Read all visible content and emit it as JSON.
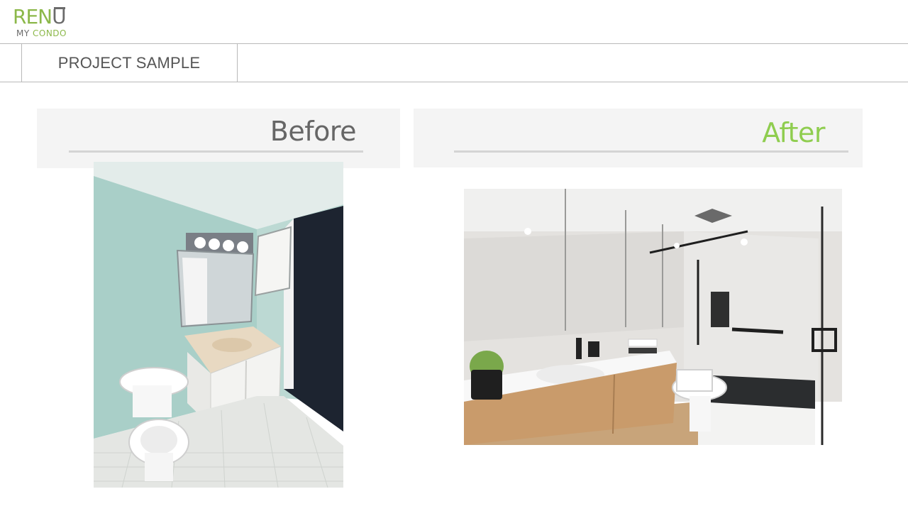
{
  "logo": {
    "word_part1": "REN",
    "word_part2": "U",
    "tagline_part1": "MY ",
    "tagline_part2": "CONDO",
    "colors": {
      "green": "#8cb84a",
      "gray": "#6b6b6b"
    }
  },
  "header": {
    "section_title": "PROJECT SAMPLE"
  },
  "before_panel": {
    "label": "Before",
    "label_color": "#666666"
  },
  "after_panel": {
    "label": "After",
    "label_color": "#8fcd4f"
  },
  "photos": {
    "before": {
      "subject": "bathroom-before-renovation"
    },
    "after": {
      "subject": "bathroom-after-renovation"
    }
  }
}
